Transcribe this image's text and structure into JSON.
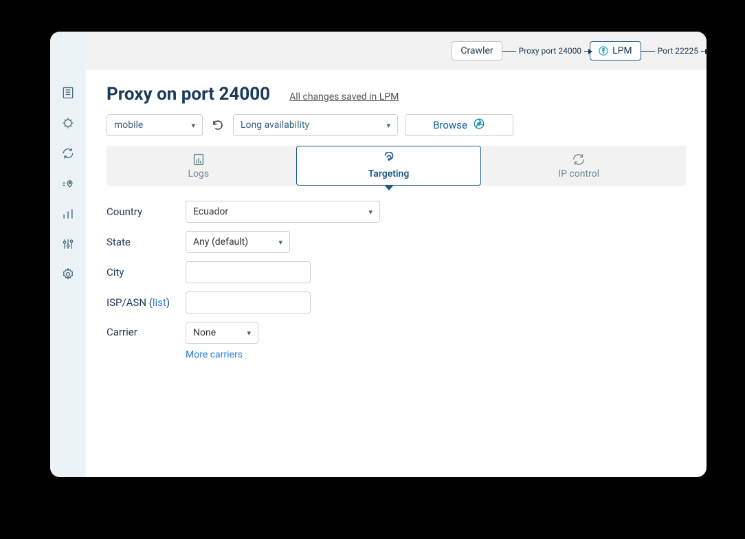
{
  "topbar": {
    "crawler": "Crawler",
    "proxy_label": "Proxy port 24000",
    "lpm": "LPM",
    "port_label": "Port 22225"
  },
  "header": {
    "title": "Proxy on port 24000",
    "saved_note": "All changes saved in LPM"
  },
  "controls": {
    "mobile": "mobile",
    "long": "Long availability",
    "browse": "Browse"
  },
  "tabs": {
    "logs": "Logs",
    "targeting": "Targeting",
    "ipcontrol": "IP control"
  },
  "form": {
    "country_label": "Country",
    "country_value": "Ecuador",
    "state_label": "State",
    "state_value": "Any (default)",
    "city_label": "City",
    "city_value": "",
    "isp_label_pre": "ISP/ASN (",
    "isp_list": "list",
    "isp_label_post": ")",
    "isp_value": "",
    "carrier_label": "Carrier",
    "carrier_value": "None",
    "more_carriers": "More carriers"
  }
}
